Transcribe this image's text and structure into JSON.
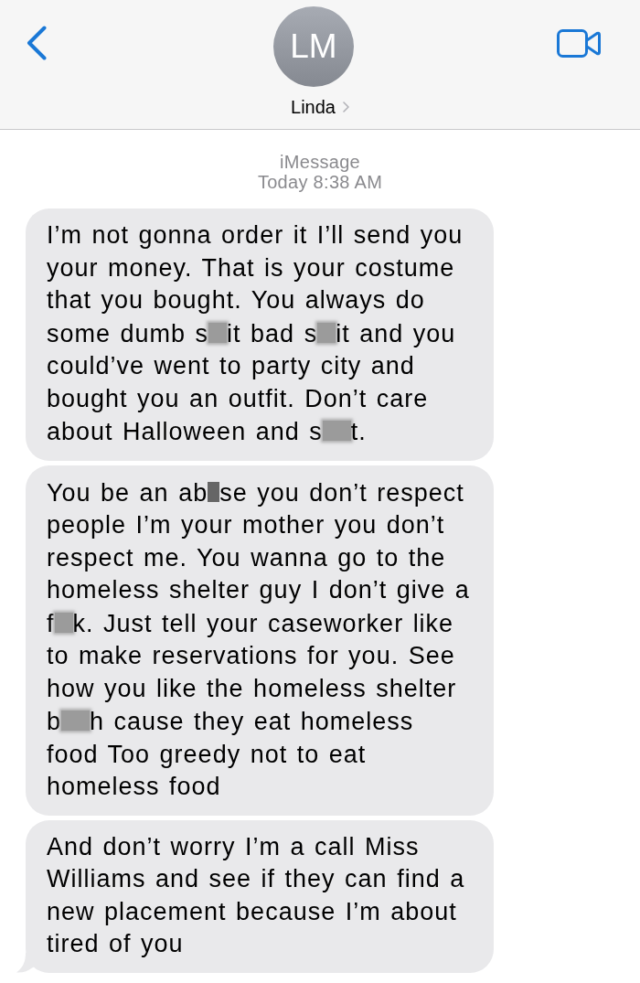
{
  "header": {
    "avatar_initials": "LM",
    "contact_name": "Linda"
  },
  "thread": {
    "service": "iMessage",
    "timestamp": "Today 8:38 AM"
  },
  "messages": [
    {
      "tail": false,
      "parts": [
        {
          "kind": "text",
          "text": "I’m not gonna order it I’ll send you your money. That is your costume that you bought. You always do some dumb s"
        },
        {
          "kind": "blur",
          "wide": false
        },
        {
          "kind": "text",
          "text": "it bad s"
        },
        {
          "kind": "blur",
          "wide": false
        },
        {
          "kind": "text",
          "text": "it and you could’ve went to party city and bought you an outfit. Don’t care about Halloween and s"
        },
        {
          "kind": "blur",
          "wide": true
        },
        {
          "kind": "text",
          "text": "t."
        }
      ]
    },
    {
      "tail": false,
      "parts": [
        {
          "kind": "text",
          "text": "You be an ab"
        },
        {
          "kind": "block"
        },
        {
          "kind": "text",
          "text": "se you don’t respect people I’m your mother you don’t respect me. You wanna go to the homeless shelter guy I don’t give a f"
        },
        {
          "kind": "blur",
          "wide": false
        },
        {
          "kind": "text",
          "text": "k. Just tell your caseworker like to make reservations for you. See how you like the homeless shelter b"
        },
        {
          "kind": "blur",
          "wide": true
        },
        {
          "kind": "text",
          "text": "h cause they eat homeless food Too greedy not to eat homeless food"
        }
      ]
    },
    {
      "tail": true,
      "parts": [
        {
          "kind": "text",
          "text": "And don’t worry I’m a call Miss Williams and see if they can find a new placement because I’m about tired of you"
        }
      ]
    }
  ]
}
